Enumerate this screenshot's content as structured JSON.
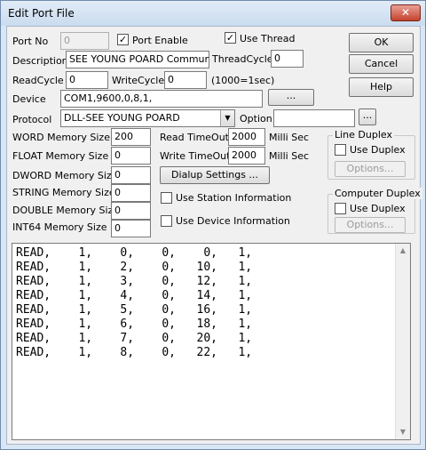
{
  "window": {
    "title": "Edit Port File",
    "close_symbol": "✕"
  },
  "fields": {
    "port_no": {
      "label": "Port No",
      "value": "0"
    },
    "port_enable": {
      "label": "Port Enable",
      "checked": true
    },
    "use_thread": {
      "label": "Use Thread",
      "checked": true
    },
    "description": {
      "label": "Description",
      "value": "SEE YOUNG POARD Communicat"
    },
    "thread_cycle": {
      "label": "ThreadCycle",
      "value": "0"
    },
    "read_cycle": {
      "label": "ReadCycle",
      "value": "0"
    },
    "write_cycle": {
      "label": "WriteCycle",
      "value": "0"
    },
    "cycle_note": "(1000=1sec)",
    "device": {
      "label": "Device",
      "value": "COM1,9600,0,8,1,",
      "browse": "..."
    },
    "protocol": {
      "label": "Protocol",
      "value": "DLL-SEE YOUNG POARD",
      "option_label": "Option",
      "option_value": "",
      "browse": "..."
    }
  },
  "memory": [
    {
      "label": "WORD Memory Size",
      "value": "200"
    },
    {
      "label": "FLOAT Memory Size",
      "value": "0"
    },
    {
      "label": "DWORD Memory Size",
      "value": "0"
    },
    {
      "label": "STRING Memory Size",
      "value": "0"
    },
    {
      "label": "DOUBLE Memory Size",
      "value": "0"
    },
    {
      "label": "INT64 Memory Size",
      "value": "0"
    }
  ],
  "timeouts": {
    "read": {
      "label": "Read TimeOut",
      "value": "2000",
      "unit": "Milli Sec"
    },
    "write": {
      "label": "Write TimeOut",
      "value": "2000",
      "unit": "Milli Sec"
    }
  },
  "dialup_button": "Dialup Settings ...",
  "use_station_info": {
    "label": "Use Station Information",
    "checked": false
  },
  "use_device_info": {
    "label": "Use Device Information",
    "checked": false
  },
  "line_duplex": {
    "title": "Line Duplex",
    "check_label": "Use Duplex",
    "options_button": "Options..."
  },
  "computer_duplex": {
    "title": "Computer Duplex",
    "check_label": "Use Duplex",
    "options_button": "Options..."
  },
  "buttons": {
    "ok": "OK",
    "cancel": "Cancel",
    "help": "Help"
  },
  "log_lines": [
    "READ,    1,    0,    0,    0,   1,",
    "READ,    1,    2,    0,   10,   1,",
    "READ,    1,    3,    0,   12,   1,",
    "READ,    1,    4,    0,   14,   1,",
    "READ,    1,    5,    0,   16,   1,",
    "READ,    1,    6,    0,   18,   1,",
    "READ,    1,    7,    0,   20,   1,",
    "READ,    1,    8,    0,   22,   1,"
  ]
}
